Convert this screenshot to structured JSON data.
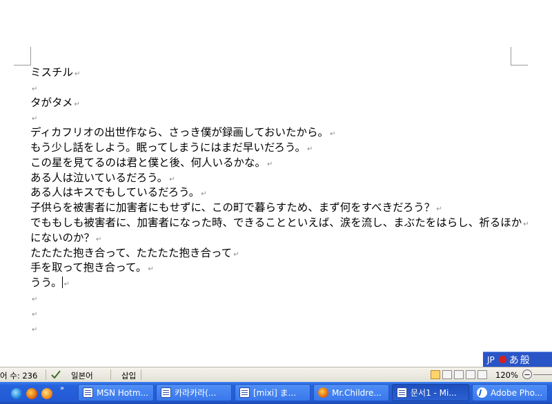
{
  "document": {
    "lines": [
      "ミスチル",
      "",
      "タがタメ",
      "",
      "ディカフリオの出世作なら、さっき僕が録画しておいたから。",
      "もう少し話をしよう。眠ってしまうにはまだ早いだろう。",
      "この星を見てるのは君と僕と後、何人いるかな。",
      "ある人は泣いているだろう。",
      "ある人はキスでもしているだろう。",
      "子供らを被害者に加害者にもせずに、この町で暮らすため、まず何をすべきだろう？",
      "でももしも被害者に、加害者になった時、できることといえば、涙を流し、まぶたをはらし、祈るほか",
      "にないのか？",
      "たたたた抱き合って、たたたた抱き合って",
      "手を取って抱き合って。",
      "うう。",
      "",
      "",
      ""
    ],
    "paragraph_mark": "↵"
  },
  "ime": {
    "lang": "JP",
    "mode": "あ",
    "extra": "般"
  },
  "status_bar": {
    "word_count": "어 수: 236",
    "language": "일본어",
    "insert_mode": "삽입",
    "zoom": "120%",
    "zoom_minus": "−"
  },
  "taskbar": {
    "chevron": "»",
    "buttons": [
      {
        "label": "MSN Hotm..."
      },
      {
        "label": "카라카라(..."
      },
      {
        "label": "[mixi] ま..."
      },
      {
        "label": "Mr.Childre..."
      },
      {
        "label": "문서1 - Mi..."
      },
      {
        "label": "Adobe Pho..."
      }
    ]
  },
  "colors": {
    "taskbar_blue": "#235ad4",
    "ime_blue": "#2a55c7",
    "status_bg": "#ebe8dd"
  }
}
